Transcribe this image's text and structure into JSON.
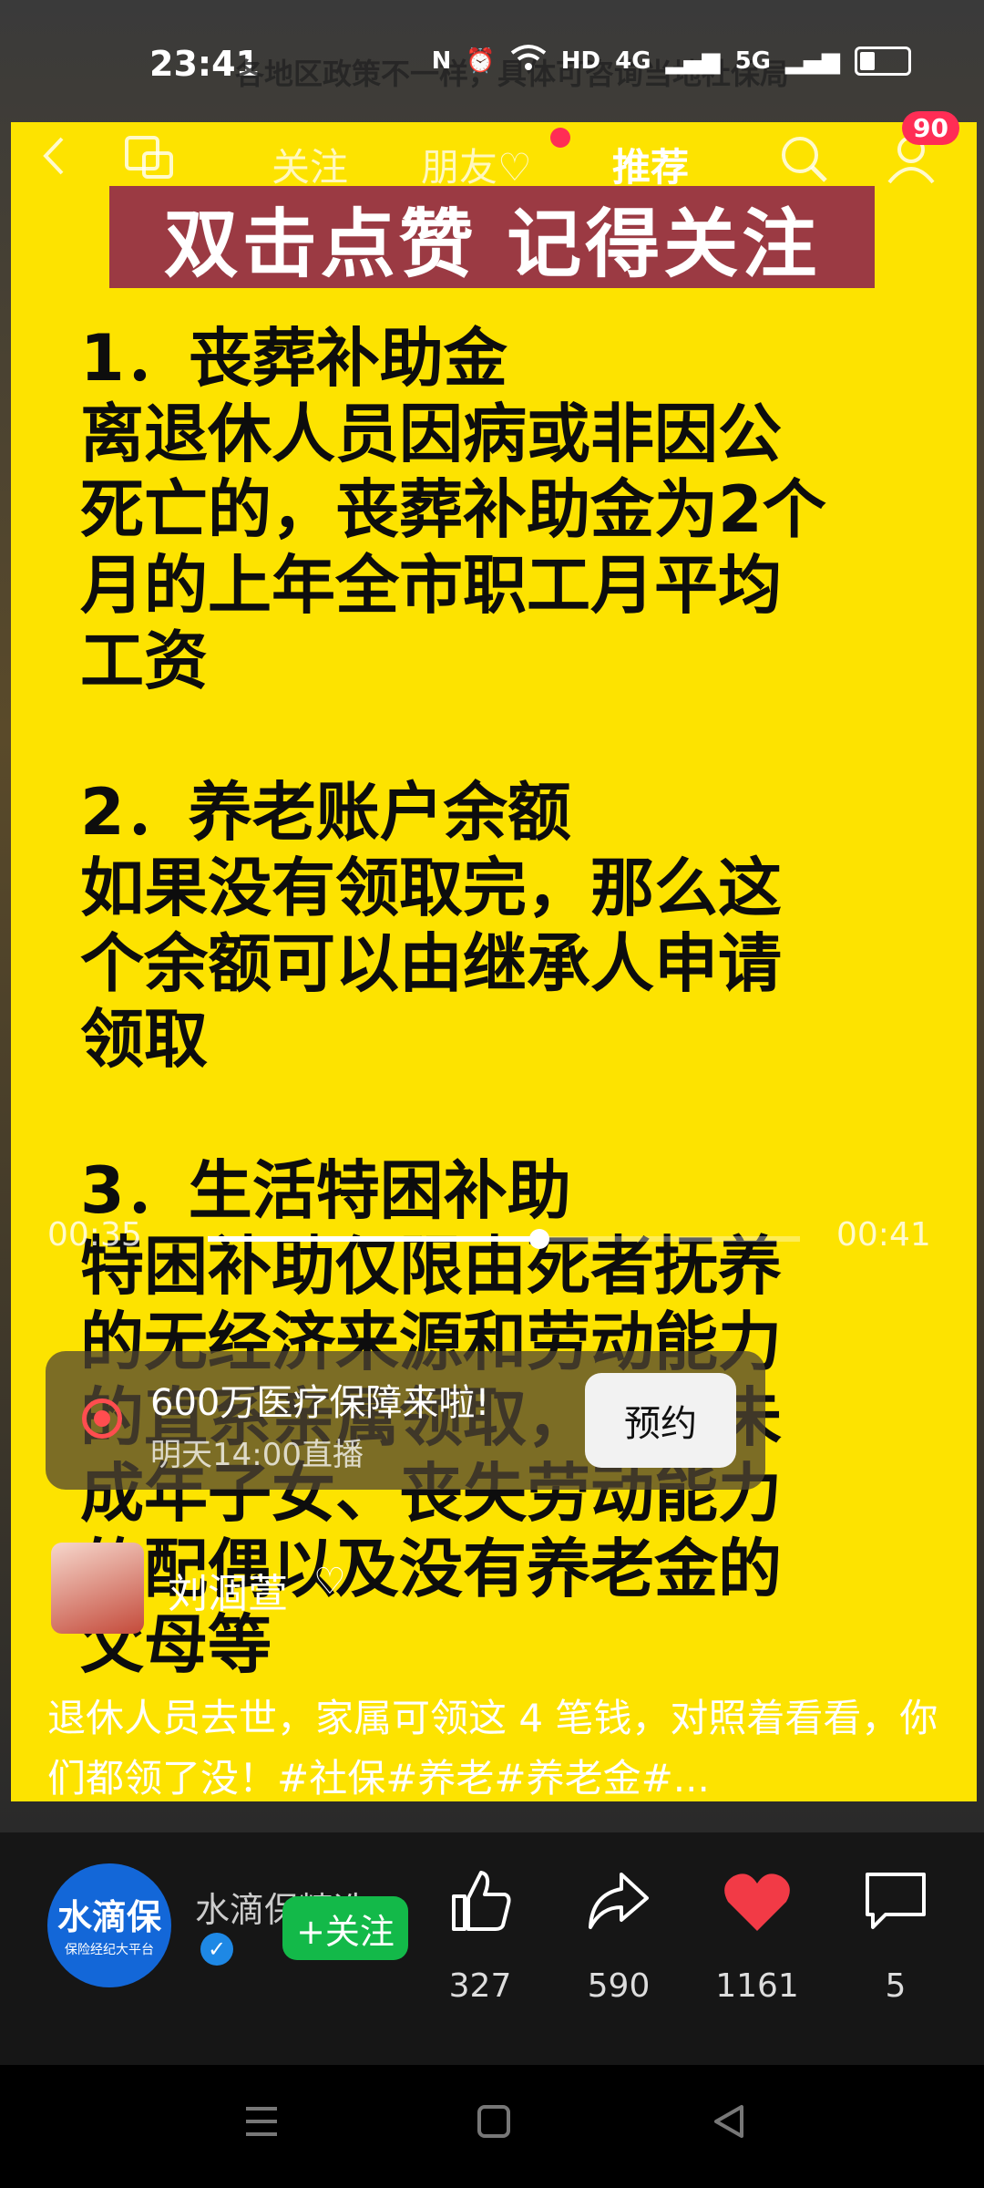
{
  "status_bar": {
    "time": "23:41",
    "overlay_text": "各地区政策不一样，具体可咨询当地社保局",
    "network": "4G",
    "network2": "5G"
  },
  "top_nav": {
    "tabs": [
      "关注",
      "朋友♡",
      "推荐"
    ],
    "active_tab": "推荐",
    "notification_count": "90"
  },
  "video": {
    "banner": "双击点赞 记得关注",
    "body": "1．丧葬补助金\n离退休人员因病或非因公\n死亡的，丧葬补助金为2个\n月的上年全市职工月平均\n工资\n\n2．养老账户余额\n如果没有领取完，那么这\n个余额可以由继承人申请\n领取\n\n3．生活特困补助\n特困补助仅限由死者抚养\n的无经济来源和劳动能力\n的直系亲属领取，比如未\n成年子女、丧失劳动能力\n的配偶以及没有养老金的\n父母等"
  },
  "progress": {
    "current": "00:35",
    "total": "00:41",
    "fraction": 0.56
  },
  "promo": {
    "title": "600万医疗保障来啦!",
    "subtitle": "明天14:00直播",
    "button": "预约"
  },
  "author": {
    "name": "刘涸萱"
  },
  "caption": "退休人员去世，家属可领这 4 笔钱，对照着看看，你们都领了没！#社保#养老#养老金#...",
  "account": {
    "logo_text": "水滴保",
    "logo_sub": "保险经纪大平台",
    "name": "水滴保精选",
    "follow_label": "+关注"
  },
  "actions": {
    "like": "327",
    "share": "590",
    "favorite": "1161",
    "comment": "5"
  },
  "colors": {
    "card": "#fde300",
    "banner": "#9b3a43",
    "follow": "#13b949",
    "heart": "#f23a46",
    "logo": "#1367d8"
  }
}
